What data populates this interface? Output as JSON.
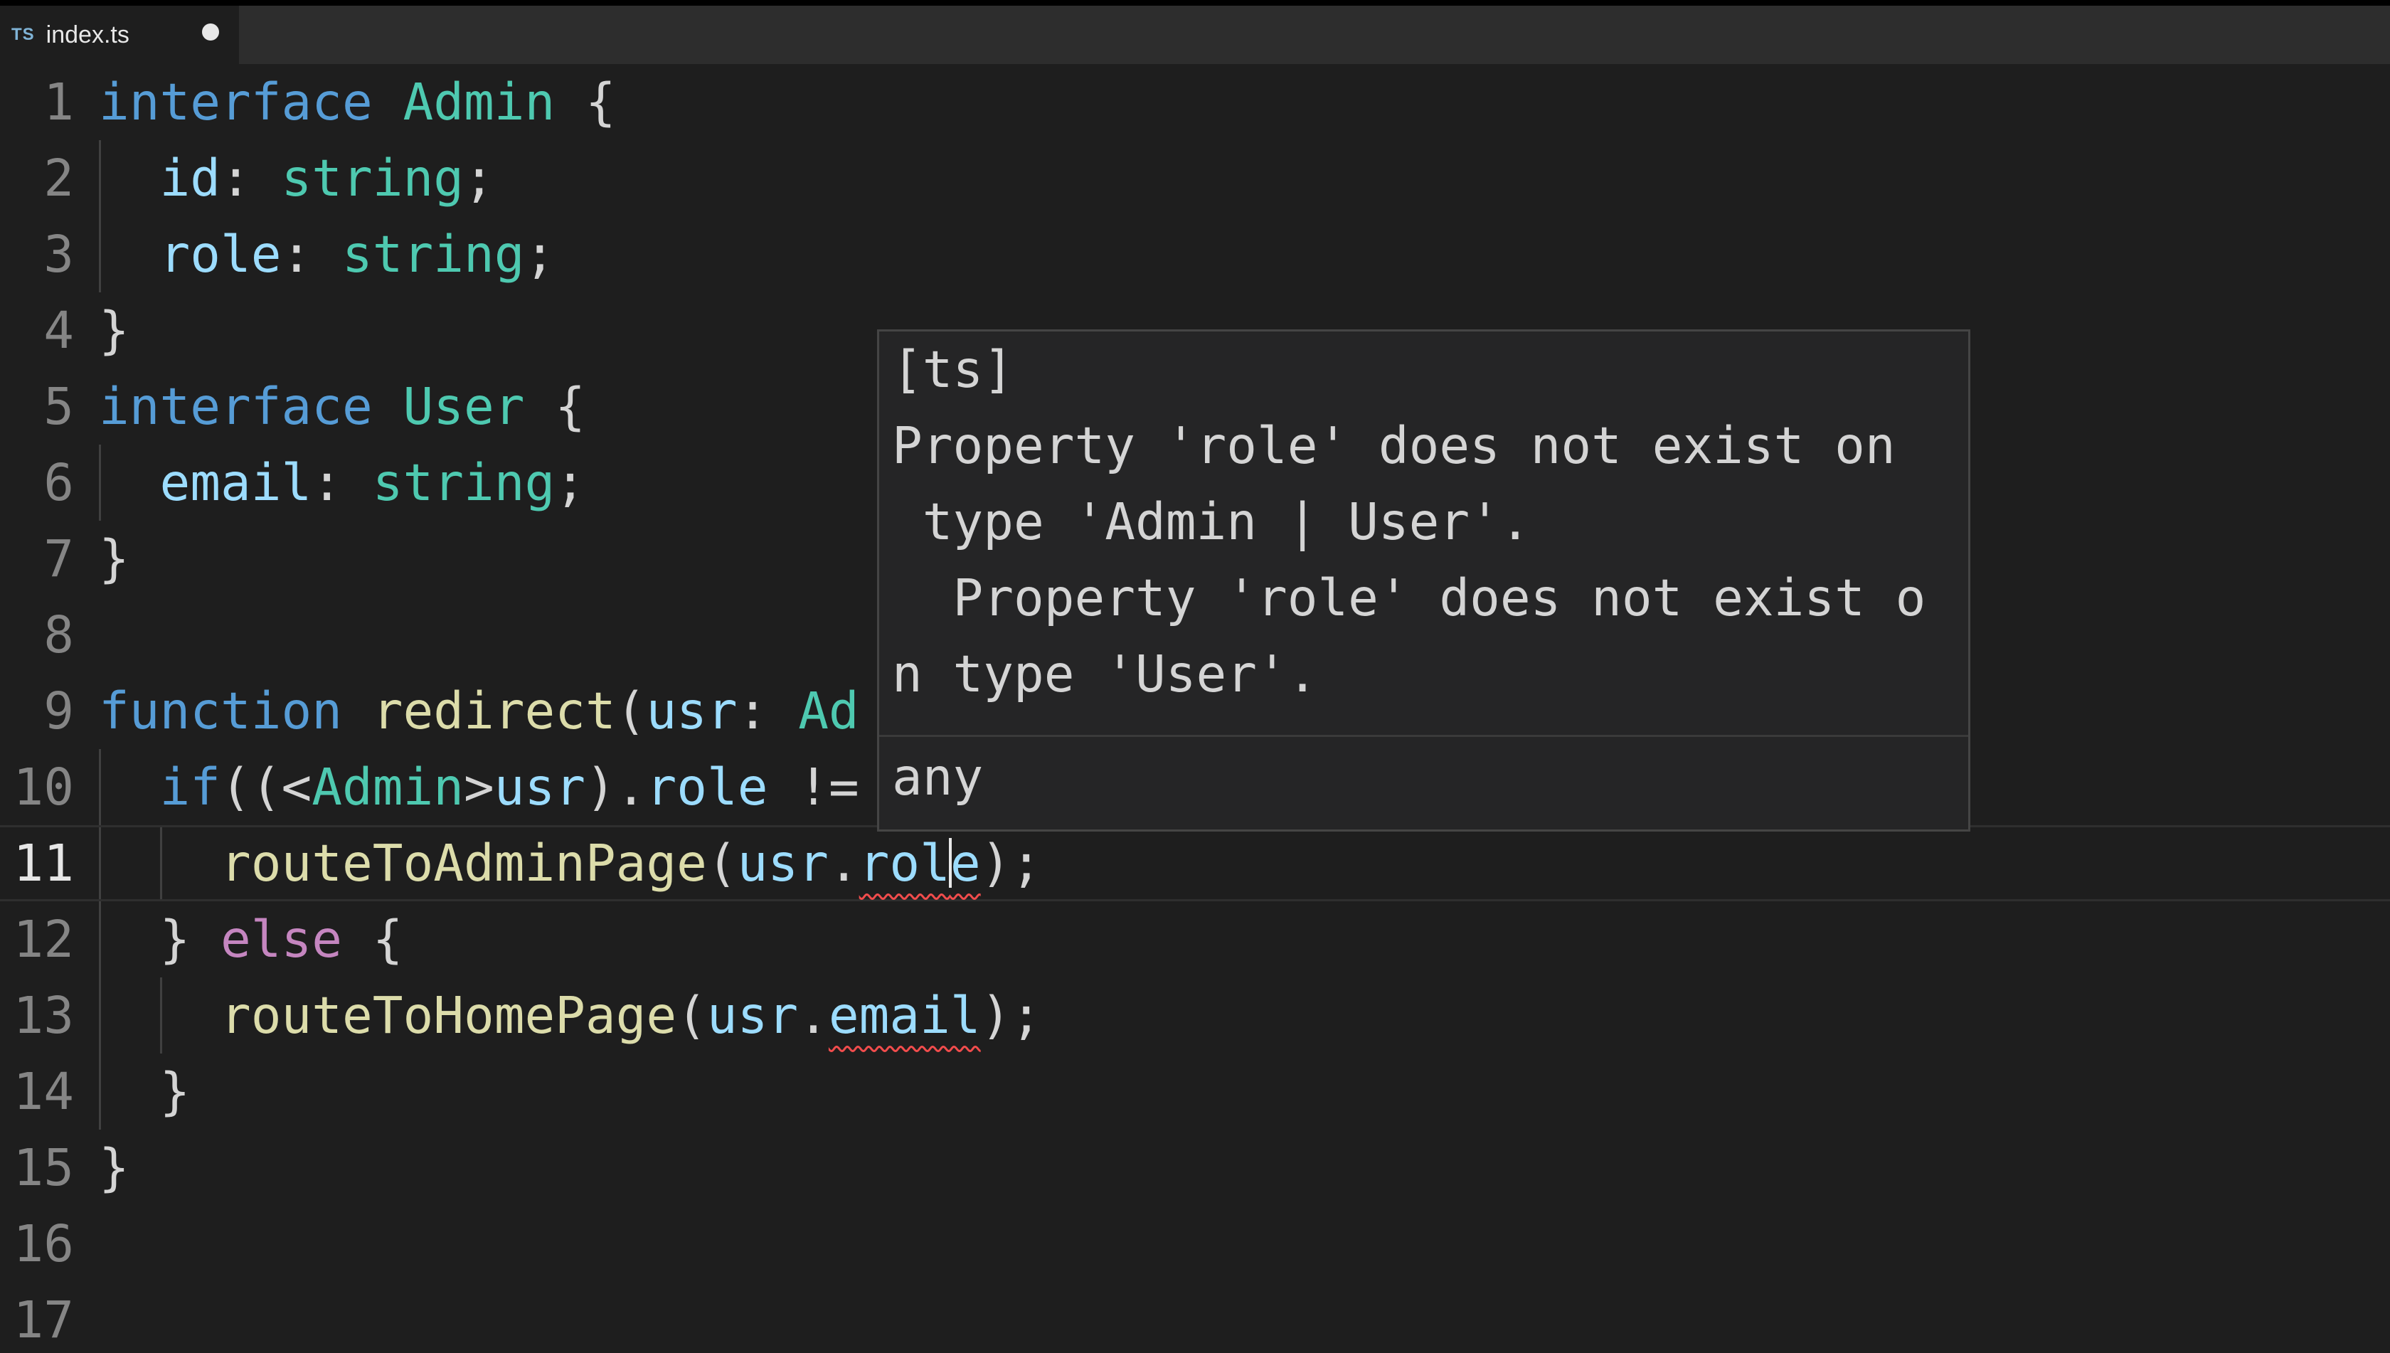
{
  "tab": {
    "lang_badge": "TS",
    "filename": "index.ts"
  },
  "code": {
    "line_numbers": [
      "1",
      "2",
      "3",
      "4",
      "5",
      "6",
      "7",
      "8",
      "9",
      "10",
      "11",
      "12",
      "13",
      "14",
      "15",
      "16",
      "17"
    ],
    "current_line": "11",
    "lines": [
      [
        {
          "k": "kw",
          "t": "interface"
        },
        {
          "k": "pu",
          "t": " "
        },
        {
          "k": "ty",
          "t": "Admin"
        },
        {
          "k": "pu",
          "t": " {"
        }
      ],
      [
        {
          "k": "pu",
          "t": "  "
        },
        {
          "k": "va",
          "t": "id"
        },
        {
          "k": "pu",
          "t": ": "
        },
        {
          "k": "ty",
          "t": "string"
        },
        {
          "k": "pu",
          "t": ";"
        }
      ],
      [
        {
          "k": "pu",
          "t": "  "
        },
        {
          "k": "va",
          "t": "role"
        },
        {
          "k": "pu",
          "t": ": "
        },
        {
          "k": "ty",
          "t": "string"
        },
        {
          "k": "pu",
          "t": ";"
        }
      ],
      [
        {
          "k": "pu",
          "t": "}"
        }
      ],
      [
        {
          "k": "kw",
          "t": "interface"
        },
        {
          "k": "pu",
          "t": " "
        },
        {
          "k": "ty",
          "t": "User"
        },
        {
          "k": "pu",
          "t": " {"
        }
      ],
      [
        {
          "k": "pu",
          "t": "  "
        },
        {
          "k": "va",
          "t": "email"
        },
        {
          "k": "pu",
          "t": ": "
        },
        {
          "k": "ty",
          "t": "string"
        },
        {
          "k": "pu",
          "t": ";"
        }
      ],
      [
        {
          "k": "pu",
          "t": "}"
        }
      ],
      [],
      [
        {
          "k": "kw",
          "t": "function"
        },
        {
          "k": "pu",
          "t": " "
        },
        {
          "k": "fn",
          "t": "redirect"
        },
        {
          "k": "pu",
          "t": "("
        },
        {
          "k": "va",
          "t": "usr"
        },
        {
          "k": "pu",
          "t": ": "
        },
        {
          "k": "ty",
          "t": "Ad"
        }
      ],
      [
        {
          "k": "pu",
          "t": "  "
        },
        {
          "k": "kw",
          "t": "if"
        },
        {
          "k": "pu",
          "t": "((<"
        },
        {
          "k": "ty",
          "t": "Admin"
        },
        {
          "k": "pu",
          "t": ">"
        },
        {
          "k": "va",
          "t": "usr"
        },
        {
          "k": "pu",
          "t": ")."
        },
        {
          "k": "va",
          "t": "role"
        },
        {
          "k": "pu",
          "t": " !="
        }
      ],
      [
        {
          "k": "pu",
          "t": "    "
        },
        {
          "k": "fn",
          "t": "routeToAdminPage"
        },
        {
          "k": "pu",
          "t": "("
        },
        {
          "k": "va",
          "t": "usr"
        },
        {
          "k": "pu",
          "t": "."
        },
        {
          "k": "va",
          "t": "rol",
          "sq": true
        },
        {
          "k": "cursor",
          "t": ""
        },
        {
          "k": "va",
          "t": "e",
          "sq": true
        },
        {
          "k": "pu",
          "t": ");"
        }
      ],
      [
        {
          "k": "pu",
          "t": "  } "
        },
        {
          "k": "ctl",
          "t": "else"
        },
        {
          "k": "pu",
          "t": " {"
        }
      ],
      [
        {
          "k": "pu",
          "t": "    "
        },
        {
          "k": "fn",
          "t": "routeToHomePage"
        },
        {
          "k": "pu",
          "t": "("
        },
        {
          "k": "va",
          "t": "usr"
        },
        {
          "k": "pu",
          "t": "."
        },
        {
          "k": "va",
          "t": "email",
          "sq": true
        },
        {
          "k": "pu",
          "t": ");"
        }
      ],
      [
        {
          "k": "pu",
          "t": "  }"
        }
      ],
      [
        {
          "k": "pu",
          "t": "}"
        }
      ],
      [],
      []
    ]
  },
  "hover": {
    "message_lines": [
      "[ts]",
      "Property 'role' does not exist on",
      " type 'Admin | User'.",
      "  Property 'role' does not exist o",
      "n type 'User'."
    ],
    "type": "any"
  }
}
